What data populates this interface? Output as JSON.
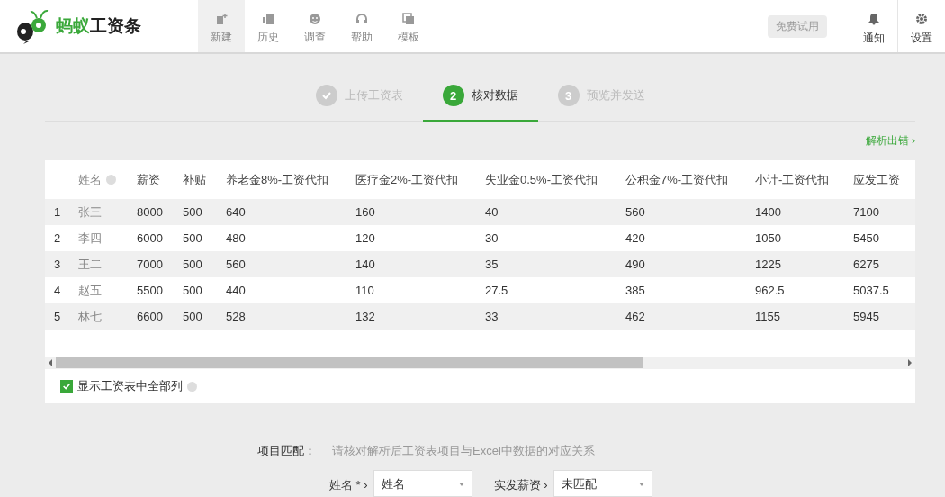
{
  "brand": {
    "parts": [
      "蚂蚁",
      "工资条"
    ]
  },
  "nav": [
    {
      "label": "新建",
      "selected": true
    },
    {
      "label": "历史",
      "selected": false
    },
    {
      "label": "调查",
      "selected": false
    },
    {
      "label": "帮助",
      "selected": false
    },
    {
      "label": "模板",
      "selected": false
    }
  ],
  "trial_button": {
    "label": "免费试用",
    "disabled": true
  },
  "header_actions": [
    {
      "label": "通知"
    },
    {
      "label": "设置"
    }
  ],
  "steps": [
    {
      "label": "上传工资表",
      "kind": "done",
      "selected": false
    },
    {
      "marker": "2",
      "label": "核对数据",
      "kind": "current",
      "selected": true
    },
    {
      "marker": "3",
      "label": "预览并发送",
      "kind": "pending",
      "selected": false
    }
  ],
  "parse_error_link": "解析出错 ›",
  "table": {
    "columns": [
      "",
      "姓名",
      "薪资",
      "补贴",
      "养老金8%-工资代扣",
      "医疗金2%-工资代扣",
      "失业金0.5%-工资代扣",
      "公积金7%-工资代扣",
      "小计-工资代扣",
      "应发工资"
    ],
    "rows": [
      [
        "1",
        "张三",
        "8000",
        "500",
        "640",
        "160",
        "40",
        "560",
        "1400",
        "7100"
      ],
      [
        "2",
        "李四",
        "6000",
        "500",
        "480",
        "120",
        "30",
        "420",
        "1050",
        "5450"
      ],
      [
        "3",
        "王二",
        "7000",
        "500",
        "560",
        "140",
        "35",
        "490",
        "1225",
        "6275"
      ],
      [
        "4",
        "赵五",
        "5500",
        "500",
        "440",
        "110",
        "27.5",
        "385",
        "962.5",
        "5037.5"
      ],
      [
        "5",
        "林七",
        "6600",
        "500",
        "528",
        "132",
        "33",
        "462",
        "1155",
        "5945"
      ]
    ]
  },
  "show_all_columns": {
    "label": "显示工资表中全部列",
    "checked": true
  },
  "matching": {
    "label": "项目匹配：",
    "hint": "请核对解析后工资表项目与Excel中数据的对应关系",
    "fields": [
      {
        "label": "姓名 * ›",
        "value": "姓名"
      },
      {
        "label": "实发薪资 ›",
        "value": "未匹配"
      }
    ]
  }
}
